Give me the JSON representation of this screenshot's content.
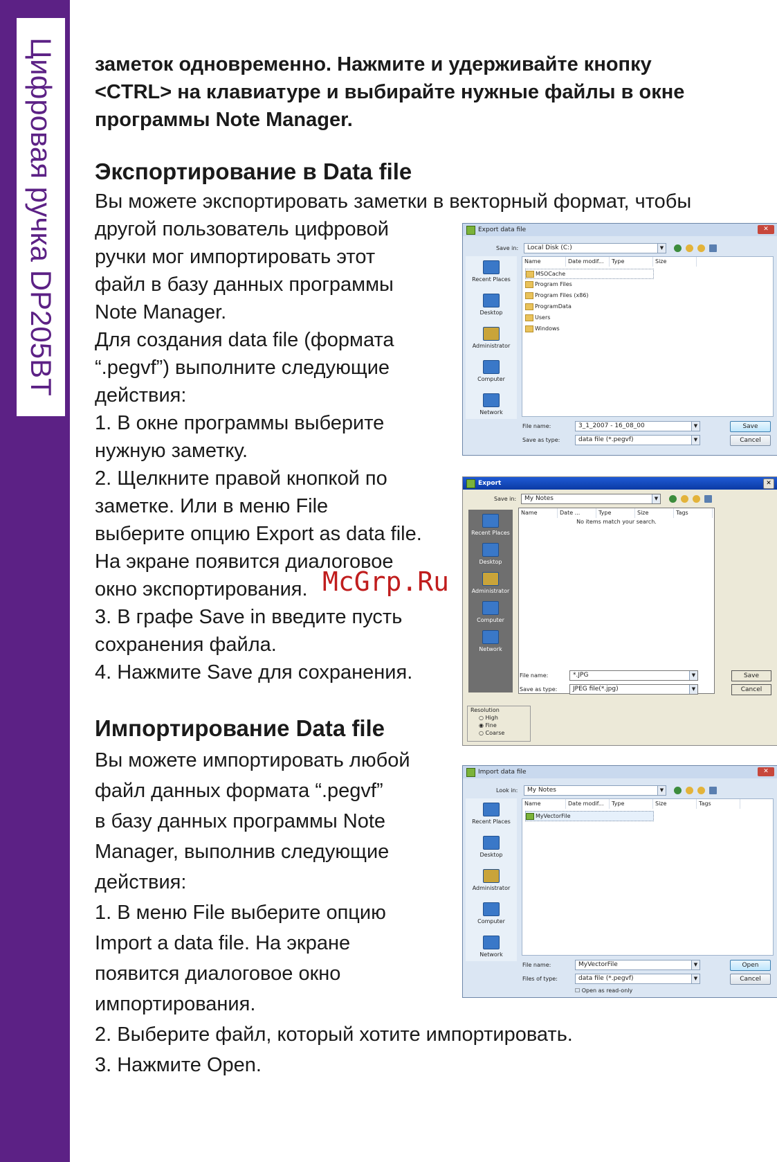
{
  "sidebar": {
    "title": "Цифровая ручка DP205BT"
  },
  "intro": {
    "line1": "заметок одновременно. Нажмите и удерживайте кнопку",
    "line2": "<CTRL> на клавиатуре и выбирайте нужные файлы в окне",
    "line3": "программы Note Manager."
  },
  "export_section": {
    "heading": "Экспортирование в Data file",
    "lines": [
      "Вы можете экспортировать заметки в векторный формат, чтобы",
      "другой пользователь цифровой",
      "ручки мог импортировать этот",
      "файл в базу данных программы",
      "Note Manager.",
      "Для создания data file (формата",
      "“.pegvf”) выполните следующие",
      "действия:",
      "1. В окне программы выберите",
      "нужную заметку.",
      "2. Щелкните правой кнопкой по",
      "заметке. Или в меню File",
      "выберите опцию Export as data file.",
      "На экране появится диалоговое",
      "окно экспортирования.",
      "3. В графе Save in введите пусть",
      "сохранения файла.",
      "4. Нажмите Save для сохранения."
    ]
  },
  "import_section": {
    "heading": "Импортирование Data file",
    "lines": [
      "Вы можете импортировать любой",
      "файл данных формата  “.pegvf”",
      "в базу данных программы Note",
      "Manager, выполнив следующие",
      "действия:",
      "1. В меню File выберите опцию",
      "Import a data file. На экране",
      "появится диалоговое окно",
      "импортирования.",
      "2. Выберите файл, который хотите импортировать.",
      "3. Нажмите Open."
    ]
  },
  "watermark": "McGrp.Ru",
  "dialog_export_data": {
    "title": "Export data file",
    "close": "✕",
    "save_in_label": "Save in:",
    "save_in_value": "Local Disk (C:)",
    "columns": [
      "Name",
      "Date modif...",
      "Type",
      "Size"
    ],
    "files": [
      "MSOCache",
      "Program Files",
      "Program Files (x86)",
      "ProgramData",
      "Users",
      "Windows"
    ],
    "places": [
      "Recent Places",
      "Desktop",
      "Administrator",
      "Computer",
      "Network"
    ],
    "file_name_label": "File name:",
    "file_name_value": "3_1_2007 - 16_08_00",
    "save_type_label": "Save as type:",
    "save_type_value": "data file (*.pegvf)",
    "save_button": "Save",
    "cancel_button": "Cancel"
  },
  "dialog_export": {
    "title": "Export",
    "close": "✕",
    "save_in_label": "Save in:",
    "save_in_value": "My Notes",
    "columns": [
      "Name",
      "Date ...",
      "Type",
      "Size",
      "Tags"
    ],
    "empty_message": "No items match your search.",
    "places": [
      "Recent Places",
      "Desktop",
      "Administrator",
      "Computer",
      "Network"
    ],
    "file_name_label": "File name:",
    "file_name_value": "*.JPG",
    "save_type_label": "Save as type:",
    "save_type_value": "JPEG file(*.jpg)",
    "save_button": "Save",
    "cancel_button": "Cancel",
    "resolution_label": "Resolution",
    "resolution_options": [
      "High",
      "Fine",
      "Coarse"
    ],
    "resolution_selected": "Fine"
  },
  "dialog_import": {
    "title": "Import data file",
    "close": "✕",
    "look_in_label": "Look in:",
    "look_in_value": "My Notes",
    "columns": [
      "Name",
      "Date modif...",
      "Type",
      "Size",
      "Tags"
    ],
    "files": [
      "MyVectorFile"
    ],
    "places": [
      "Recent Places",
      "Desktop",
      "Administrator",
      "Computer",
      "Network"
    ],
    "file_name_label": "File name:",
    "file_name_value": "MyVectorFile",
    "file_type_label": "Files of type:",
    "file_type_value": "data file (*.pegvf)",
    "readonly_label": "Open as read-only",
    "open_button": "Open",
    "cancel_button": "Cancel"
  }
}
